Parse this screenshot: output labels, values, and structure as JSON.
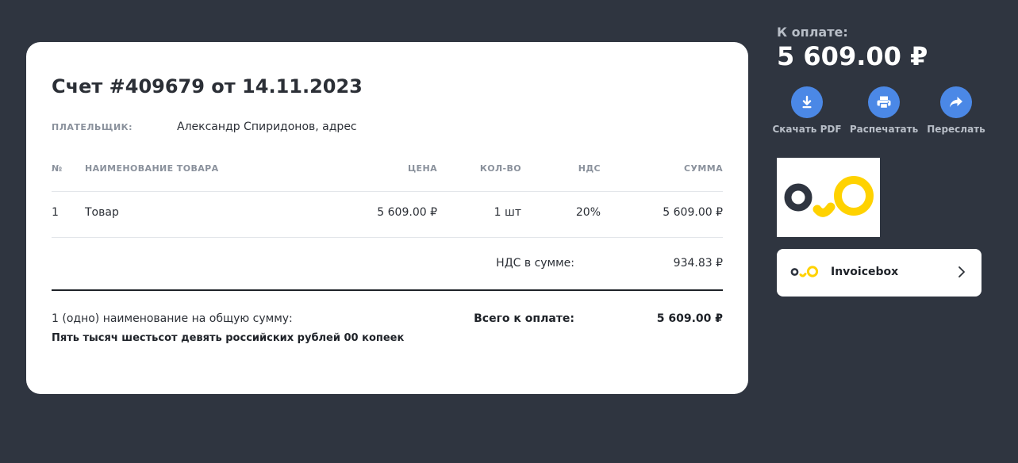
{
  "invoice": {
    "title": "Счет #409679 от 14.11.2023",
    "payer_label": "ПЛАТЕЛЬЩИК:",
    "payer_value": "Александр Спиридонов, адрес",
    "columns": {
      "num": "№",
      "name": "НАИМЕНОВАНИЕ ТОВАРА",
      "price": "ЦЕНА",
      "qty": "КОЛ-ВО",
      "vat": "НДС",
      "sum": "СУММА"
    },
    "rows": [
      {
        "num": "1",
        "name": "Товар",
        "price": "5 609.00 ₽",
        "qty": "1 шт",
        "vat": "20%",
        "sum": "5 609.00 ₽"
      }
    ],
    "vat_total_label": "НДС в сумме:",
    "vat_total_value": "934.83 ₽",
    "summary_count": "1 (одно) наименование на общую сумму:",
    "summary_words": "Пять тысяч шестьсот девять российских рублей 00 копеек",
    "grand_total_label": "Всего к оплате:",
    "grand_total_value": "5 609.00 ₽"
  },
  "payment": {
    "label": "К оплате:",
    "amount": "5 609.00 ₽",
    "actions": [
      {
        "label": "Скачать PDF",
        "icon": "download-icon"
      },
      {
        "label": "Распечатать",
        "icon": "print-icon"
      },
      {
        "label": "Переслать",
        "icon": "share-icon"
      }
    ]
  },
  "brand": {
    "name": "Invoicebox",
    "logo_colors": {
      "dark": "#2f3540",
      "yellow": "#ffd200"
    }
  },
  "colors": {
    "background": "#2f3540",
    "accent": "#4b88e6"
  }
}
